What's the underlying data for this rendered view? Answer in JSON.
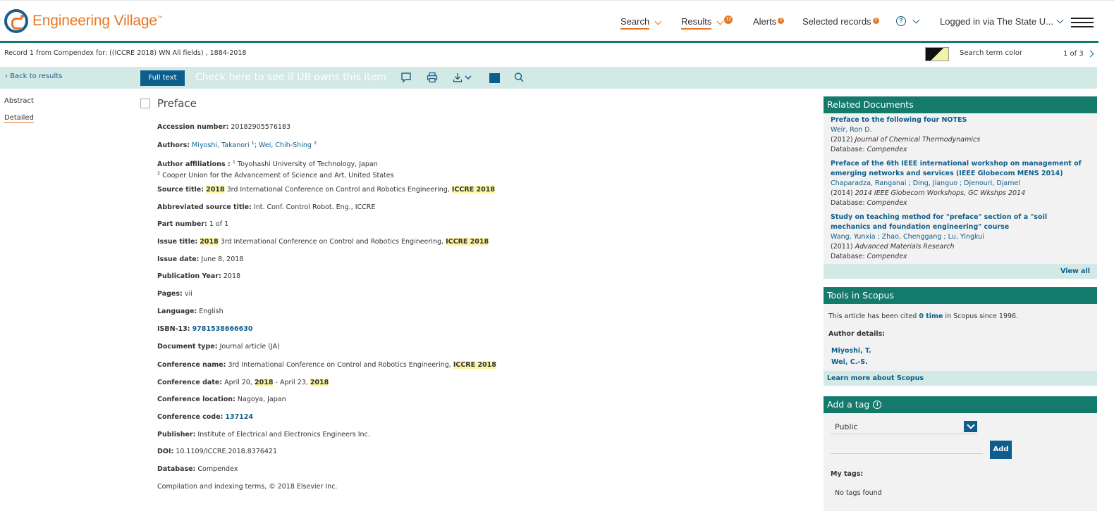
{
  "header": {
    "logo_text": "Engineering Village",
    "logo_tm": "™",
    "nav": {
      "search": "Search",
      "results": "Results",
      "results_count": "12",
      "alerts": "Alerts",
      "alerts_count": "0",
      "selected_records": "Selected records",
      "selected_count": "0",
      "help": "?",
      "logged_in": "Logged in via The State U..."
    }
  },
  "record_bar": {
    "record_text": "Record 1 from Compendex for: ((ICCRE 2018) WN All fields) , 1884-2018",
    "search_term_color": "Search term color",
    "pager": "1 of 3"
  },
  "toolbar": {
    "back": "Back to results",
    "full_text": "Full text",
    "ub_check": "Check here to see if UB owns this item"
  },
  "left_tabs": [
    "Abstract",
    "Detailed"
  ],
  "document": {
    "title": "Preface",
    "accession_label": "Accession number:",
    "accession_value": "20182905576183",
    "authors_label": "Authors:",
    "author1": "Miyoshi, Takanori",
    "author1_sup": "1",
    "author_sep": ";",
    "author2": "Wei, Chih-Shing",
    "author2_sup": "2",
    "affil_label": "Author affiliations :",
    "affil1_sup": "1",
    "affil1": "Toyohashi University of Technology, Japan",
    "affil2_sup": "2",
    "affil2": "Cooper Union for the Advancement of Science and Art, United States",
    "source_label": "Source title:",
    "source_hl1": "2018",
    "source_mid": "3rd International Conference on Control and Robotics Engineering,",
    "source_hl2": "ICCRE 2018",
    "abbr_label": "Abbreviated source title:",
    "abbr_value": "Int. Conf. Control Robot. Eng., ICCRE",
    "part_label": "Part number:",
    "part_value": "1 of 1",
    "issue_title_label": "Issue title:",
    "issue_hl1": "2018",
    "issue_mid": "3rd International Conference on Control and Robotics Engineering,",
    "issue_hl2": "ICCRE 2018",
    "issue_date_label": "Issue date:",
    "issue_date_value": "June 8, 2018",
    "pubyear_label": "Publication Year:",
    "pubyear_value": "2018",
    "pages_label": "Pages:",
    "pages_value": "vii",
    "language_label": "Language:",
    "language_value": "English",
    "isbn_label": "ISBN-13:",
    "isbn_value": "9781538666630",
    "doctype_label": "Document type:",
    "doctype_value": "Journal article (JA)",
    "confname_label": "Conference name:",
    "confname_mid": "3rd International Conference on Control and Robotics Engineering,",
    "confname_hl": "ICCRE 2018",
    "confdate_label": "Conference date:",
    "confdate_a": "April 20,",
    "confdate_hl1": "2018",
    "confdate_b": "- April 23,",
    "confdate_hl2": "2018",
    "confloc_label": "Conference location:",
    "confloc_value": "Nagoya, Japan",
    "confcode_label": "Conference code:",
    "confcode_value": "137124",
    "publisher_label": "Publisher:",
    "publisher_value": "Institute of Electrical and Electronics Engineers Inc.",
    "doi_label": "DOI:",
    "doi_value": "10.1109/ICCRE.2018.8376421",
    "database_label": "Database:",
    "database_value": "Compendex",
    "copyright": "Compilation and indexing terms, © 2018 Elsevier Inc."
  },
  "related": {
    "header": "Related Documents",
    "items": [
      {
        "title": "Preface to the following four NOTES",
        "authors": "Weir, Ron D.",
        "year": "(2012)",
        "source": "Journal of Chemical Thermodynamics",
        "db_label": "Database:",
        "db": "Compendex"
      },
      {
        "title": "Preface of the 6th IEEE international workshop on management of emerging networks and services (IEEE Globecom MENS 2014)",
        "authors": "Chaparadza, Ranganai ; Ding, Jianguo ; Djenouri, Djamel",
        "year": "(2014)",
        "source": "2014 IEEE Globecom Workshops, GC Wkshps 2014",
        "db_label": "Database:",
        "db": "Compendex"
      },
      {
        "title": "Study on teaching method for \"preface\" section of a \"soil mechanics and foundation engineering\" course",
        "authors": "Wang, Yunxia ; Zhao, Chenggang ; Lu, Yingkui",
        "year": "(2011)",
        "source": "Advanced Materials Research",
        "db_label": "Database:",
        "db": "Compendex"
      }
    ],
    "view_all": "View all"
  },
  "scopus": {
    "header": "Tools in Scopus",
    "cited_a": "This article has been cited",
    "cited_link": "0 time",
    "cited_b": "in Scopus since 1996.",
    "author_details": "Author details:",
    "author1": "Miyoshi, T.",
    "author2": "Wei, C.-S.",
    "learn_more": "Learn more about Scopus"
  },
  "tags": {
    "header": "Add a tag",
    "info": "i",
    "visibility": "Public",
    "add": "Add",
    "my_tags": "My tags:",
    "no_tags": "No tags found"
  }
}
